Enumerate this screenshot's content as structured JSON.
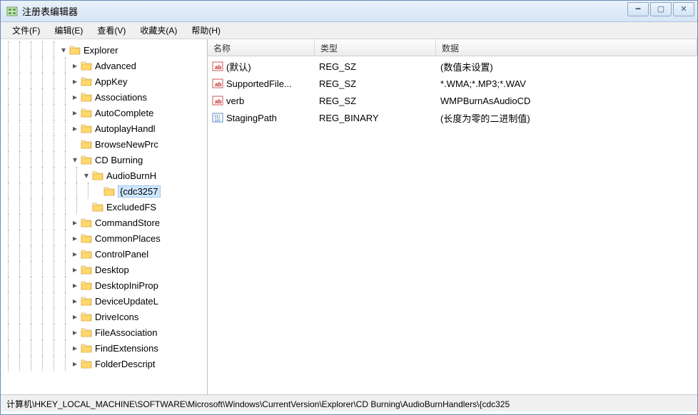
{
  "window": {
    "title": "注册表编辑器"
  },
  "menu": {
    "file": "文件(F)",
    "edit": "编辑(E)",
    "view": "查看(V)",
    "favorites": "收藏夹(A)",
    "help": "帮助(H)"
  },
  "tree": {
    "items": [
      {
        "depth": 5,
        "expanded": true,
        "label": "Explorer"
      },
      {
        "depth": 6,
        "expanded": false,
        "label": "Advanced"
      },
      {
        "depth": 6,
        "expanded": false,
        "label": "AppKey"
      },
      {
        "depth": 6,
        "expanded": false,
        "label": "Associations"
      },
      {
        "depth": 6,
        "expanded": false,
        "label": "AutoComplete"
      },
      {
        "depth": 6,
        "expanded": false,
        "label": "AutoplayHandl"
      },
      {
        "depth": 6,
        "expanded": null,
        "label": "BrowseNewPrc"
      },
      {
        "depth": 6,
        "expanded": true,
        "label": "CD Burning"
      },
      {
        "depth": 7,
        "expanded": true,
        "label": "AudioBurnH"
      },
      {
        "depth": 8,
        "expanded": null,
        "label": "{cdc3257",
        "selected": true
      },
      {
        "depth": 7,
        "expanded": null,
        "label": "ExcludedFS"
      },
      {
        "depth": 6,
        "expanded": false,
        "label": "CommandStore"
      },
      {
        "depth": 6,
        "expanded": false,
        "label": "CommonPlaces"
      },
      {
        "depth": 6,
        "expanded": false,
        "label": "ControlPanel"
      },
      {
        "depth": 6,
        "expanded": false,
        "label": "Desktop"
      },
      {
        "depth": 6,
        "expanded": false,
        "label": "DesktopIniProp"
      },
      {
        "depth": 6,
        "expanded": false,
        "label": "DeviceUpdateL"
      },
      {
        "depth": 6,
        "expanded": false,
        "label": "DriveIcons"
      },
      {
        "depth": 6,
        "expanded": false,
        "label": "FileAssociation"
      },
      {
        "depth": 6,
        "expanded": false,
        "label": "FindExtensions"
      },
      {
        "depth": 6,
        "expanded": false,
        "label": "FolderDescript"
      }
    ]
  },
  "list": {
    "columns": {
      "name": "名称",
      "type": "类型",
      "data": "数据"
    },
    "rows": [
      {
        "icon": "string",
        "name": "(默认)",
        "type": "REG_SZ",
        "data": "(数值未设置)"
      },
      {
        "icon": "string",
        "name": "SupportedFile...",
        "type": "REG_SZ",
        "data": "*.WMA;*.MP3;*.WAV"
      },
      {
        "icon": "string",
        "name": "verb",
        "type": "REG_SZ",
        "data": "WMPBurnAsAudioCD"
      },
      {
        "icon": "binary",
        "name": "StagingPath",
        "type": "REG_BINARY",
        "data": "(长度为零的二进制值)",
        "highlight": true
      }
    ]
  },
  "statusbar": {
    "path": "计算机\\HKEY_LOCAL_MACHINE\\SOFTWARE\\Microsoft\\Windows\\CurrentVersion\\Explorer\\CD Burning\\AudioBurnHandlers\\{cdc325"
  }
}
